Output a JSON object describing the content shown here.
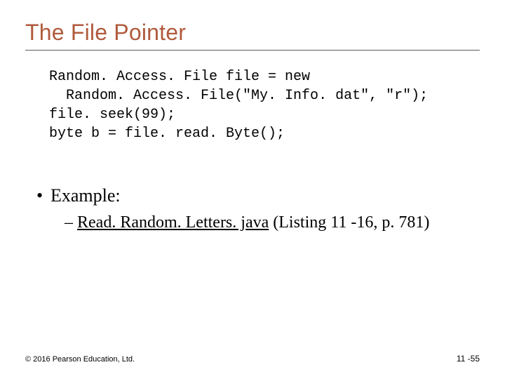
{
  "title": "The File Pointer",
  "code": "Random. Access. File file = new\n  Random. Access. File(\"My. Info. dat\", \"r\");\nfile. seek(99);\nbyte b = file. read. Byte();",
  "example": {
    "label": "Example:",
    "link_text": "Read. Random. Letters. java",
    "listing_text": " (Listing 11 -16, p. 781)"
  },
  "footer": {
    "copyright": "© 2016 Pearson Education, Ltd.",
    "page": "11 -55"
  }
}
